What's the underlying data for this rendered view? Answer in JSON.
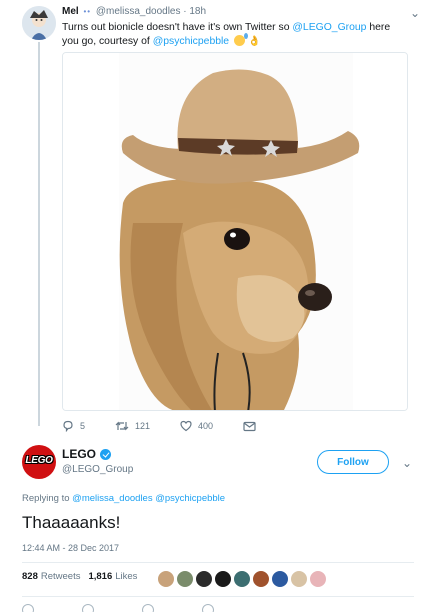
{
  "tweet1": {
    "name": "Mel",
    "name_suffix": "••",
    "handle": "@melissa_doodles",
    "time": "· 18h",
    "text_before": "Turns out bionicle doesn't have it's own Twitter so ",
    "mention1": "@LEGO_Group",
    "text_middle": " here you go, courtesy of ",
    "mention2": "@psychicpebble",
    "emojis": [
      "grimacing-sweat-emoji",
      "ok-hand-emoji"
    ],
    "media_alt": "photo of small dog wearing a cowboy hat",
    "actions": {
      "reply_count": "5",
      "retweet_count": "121",
      "like_count": "400",
      "message": ""
    }
  },
  "tweet2": {
    "logo_text": "LEGO",
    "name": "LEGO",
    "verified": true,
    "handle": "@LEGO_Group",
    "follow_label": "Follow",
    "replying_prefix": "Replying to ",
    "replying_mentions": "@melissa_doodles @psychicpebble",
    "text": "Thaaaaanks!",
    "timestamp": "12:44 AM - 28 Dec 2017",
    "retweets_count": "828",
    "retweets_label": "Retweets",
    "likes_count": "1,816",
    "likes_label": "Likes",
    "liker_colors": [
      "#c8a27a",
      "#7a8c6b",
      "#2b2b2b",
      "#1a1a1a",
      "#3c6e71",
      "#a0522d",
      "#2c5aa0",
      "#d8c3a5",
      "#e8b4b8"
    ]
  },
  "colors": {
    "accent": "#1da1f2",
    "muted": "#657786",
    "lego_red": "#d01012"
  }
}
